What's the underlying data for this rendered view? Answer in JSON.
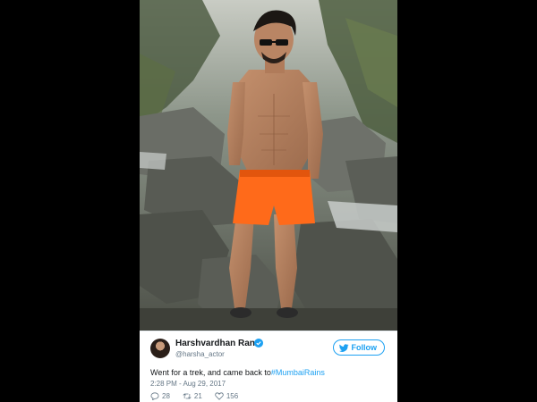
{
  "tweet": {
    "display_name": "Harshvardhan Rane",
    "handle": "@harsha_actor",
    "follow_label": "Follow",
    "text_prefix": "Went for a trek, and came back to",
    "hashtag": "#MumbaiRains",
    "timestamp": "2:28 PM - Aug 29, 2017",
    "replies": "28",
    "retweets": "21",
    "likes": "156"
  },
  "colors": {
    "accent": "#1da1f2",
    "text": "#14171a",
    "muted": "#657786",
    "shorts": "#ff6a1a"
  },
  "icons": {
    "verified": "verified-badge-icon",
    "follow": "twitter-bird-icon",
    "reply": "reply-icon",
    "retweet": "retweet-icon",
    "like": "heart-icon"
  }
}
